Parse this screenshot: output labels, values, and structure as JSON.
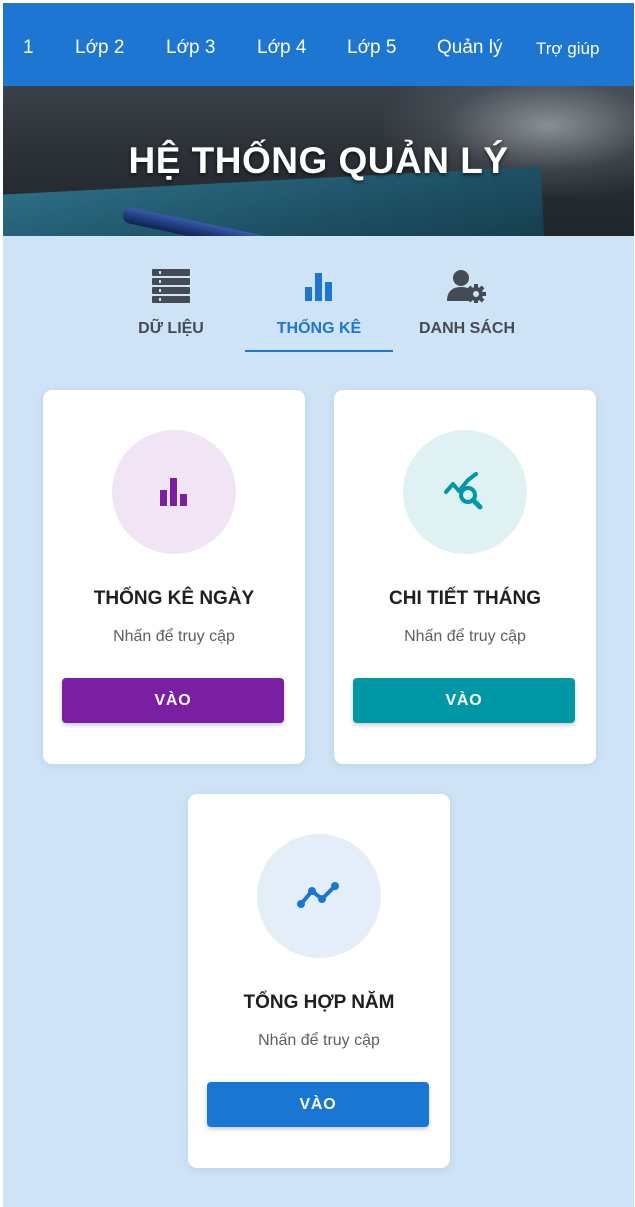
{
  "nav": {
    "items": [
      "1",
      "Lớp 2",
      "Lớp 3",
      "Lớp 4",
      "Lớp 5",
      "Quản lý",
      "Trợ giúp"
    ]
  },
  "hero": {
    "title": "HỆ THỐNG QUẢN LÝ"
  },
  "tabs": [
    {
      "label": "DỮ LIỆU",
      "icon": "list-icon",
      "active": false
    },
    {
      "label": "THỐNG KÊ",
      "icon": "bar-chart-icon",
      "active": true
    },
    {
      "label": "DANH SÁCH",
      "icon": "user-settings-icon",
      "active": false
    }
  ],
  "cards": [
    {
      "title": "THỐNG KÊ NGÀY",
      "subtitle": "Nhấn để truy cập",
      "button": "VÀO",
      "icon": "bar-chart-icon",
      "accent": "#7b1fa2",
      "circle_bg": "#f1e4f5"
    },
    {
      "title": "CHI TIẾT THÁNG",
      "subtitle": "Nhấn để truy cập",
      "button": "VÀO",
      "icon": "chart-search-icon",
      "accent": "#0097a7",
      "circle_bg": "#dff1f2"
    },
    {
      "title": "TỔNG HỢP NĂM",
      "subtitle": "Nhấn để truy cập",
      "button": "VÀO",
      "icon": "line-chart-icon",
      "accent": "#1976d2",
      "circle_bg": "#e3eef9"
    }
  ],
  "colors": {
    "primary": "#1c76d2",
    "page_bg": "#cfe3f7",
    "tab_inactive": "#454b55"
  }
}
